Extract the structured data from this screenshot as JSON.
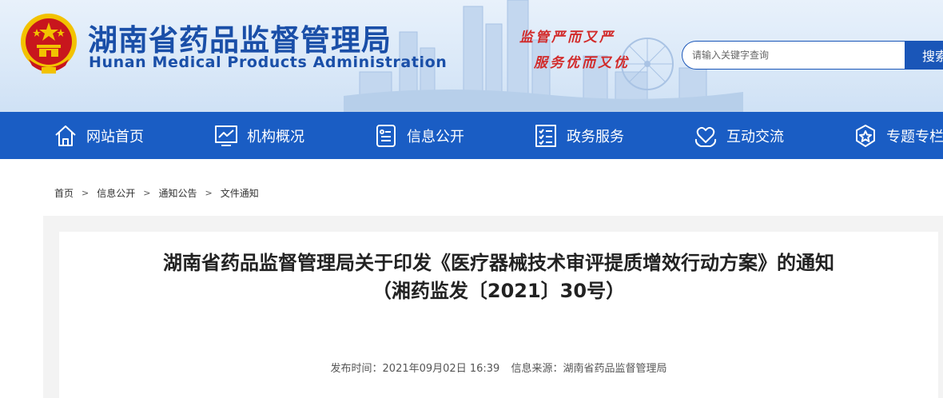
{
  "header": {
    "title": "湖南省药品监督管理局",
    "subtitle": "Hunan Medical Products Administration",
    "slogan_line1": "监管严而又严",
    "slogan_line2": "服务优而又优",
    "search": {
      "placeholder": "请输入关键字查询",
      "button_label": "搜索"
    }
  },
  "nav": {
    "items": [
      {
        "label": "网站首页",
        "icon": "home-icon"
      },
      {
        "label": "机构概况",
        "icon": "chart-monitor-icon"
      },
      {
        "label": "信息公开",
        "icon": "document-list-icon"
      },
      {
        "label": "政务服务",
        "icon": "checklist-icon"
      },
      {
        "label": "互动交流",
        "icon": "heart-hands-icon"
      },
      {
        "label": "专题专栏",
        "icon": "star-badge-icon"
      }
    ]
  },
  "breadcrumb": [
    "首页",
    "信息公开",
    "通知公告",
    "文件通知"
  ],
  "article": {
    "title_line1": "湖南省药品监督管理局关于印发《医疗器械技术审评提质增效行动方案》的通知",
    "title_line2": "（湘药监发〔2021〕30号）",
    "publish_time": "发布时间：2021年09月02日 16:39",
    "source": "信息来源：湖南省药品监督管理局"
  },
  "colors": {
    "brand_blue": "#1a4fa8",
    "nav_blue": "#1a5dc4",
    "slogan_red": "#d22b2b",
    "emblem_red": "#c8161d",
    "emblem_gold": "#f2c200"
  }
}
